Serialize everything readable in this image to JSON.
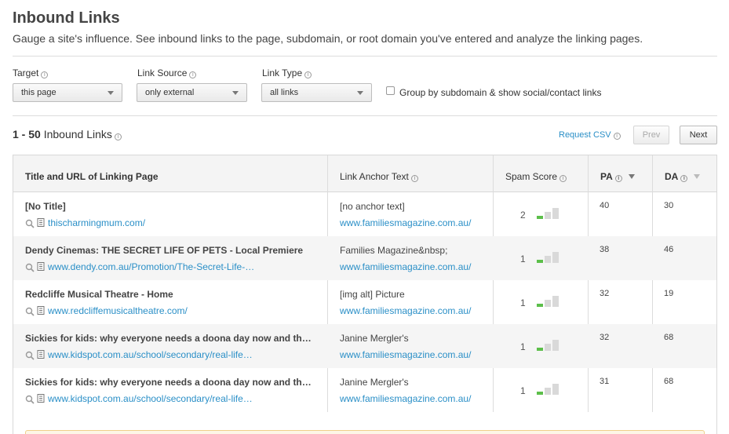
{
  "header": {
    "title": "Inbound Links",
    "subtitle": "Gauge a site's influence. See inbound links to the page, subdomain, or root domain you've entered and analyze the linking pages."
  },
  "filters": {
    "target": {
      "label": "Target",
      "value": "this page"
    },
    "link_source": {
      "label": "Link Source",
      "value": "only external"
    },
    "link_type": {
      "label": "Link Type",
      "value": "all links"
    },
    "group_checkbox": {
      "label": "Group by subdomain & show social/contact links",
      "checked": false
    }
  },
  "results": {
    "range": "1 - 50",
    "range_label": "Inbound Links",
    "request_csv": "Request CSV",
    "prev": "Prev",
    "next": "Next"
  },
  "table": {
    "headers": {
      "title_url": "Title and URL of Linking Page",
      "anchor": "Link Anchor Text",
      "spam": "Spam Score",
      "pa": "PA",
      "da": "DA"
    },
    "rows": [
      {
        "title": "[No Title]",
        "url": "thischarmingmum.com/",
        "anchor": "[no anchor text]",
        "anchor_url": "www.familiesmagazine.com.au/",
        "spam": "2",
        "pa": "40",
        "da": "30"
      },
      {
        "title": "Dendy Cinemas: THE SECRET LIFE OF PETS - Local Premiere",
        "url": "www.dendy.com.au/Promotion/The-Secret-Life-…",
        "anchor": "Families Magazine&nbsp;",
        "anchor_url": "www.familiesmagazine.com.au/",
        "spam": "1",
        "pa": "38",
        "da": "46"
      },
      {
        "title": "Redcliffe Musical Theatre - Home",
        "url": "www.redcliffemusicaltheatre.com/",
        "anchor": "[img alt] Picture",
        "anchor_url": "www.familiesmagazine.com.au/",
        "spam": "1",
        "pa": "32",
        "da": "19"
      },
      {
        "title": "Sickies for kids: why everyone needs a doona day now and th…",
        "url": "www.kidspot.com.au/school/secondary/real-life…",
        "anchor": "Janine Mergler's",
        "anchor_url": "www.familiesmagazine.com.au/",
        "spam": "1",
        "pa": "32",
        "da": "68"
      },
      {
        "title": "Sickies for kids: why everyone needs a doona day now and th…",
        "url": "www.kidspot.com.au/school/secondary/real-life…",
        "anchor": "Janine Mergler's",
        "anchor_url": "www.familiesmagazine.com.au/",
        "spam": "1",
        "pa": "31",
        "da": "68"
      }
    ]
  },
  "colors": {
    "link": "#2a8fc7",
    "spam_low": "#5cbf4a",
    "spam_empty": "#d9d9d9"
  },
  "icons": {
    "info": "info-icon",
    "inspect": "magnifier-icon",
    "page": "page-icon",
    "sort": "sort-arrow-icon"
  }
}
